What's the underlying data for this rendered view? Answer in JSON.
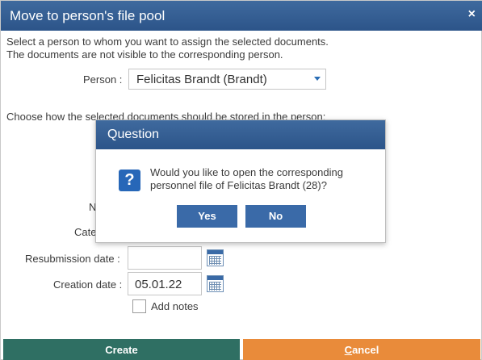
{
  "window": {
    "title": "Move to person's file pool",
    "close_glyph": "×"
  },
  "intro": {
    "line1": "Select a person to whom you want to assign the selected documents.",
    "line2": "The documents are not visible to the corresponding person."
  },
  "person": {
    "label": "Person :",
    "value": "Felicitas Brandt (Brandt)"
  },
  "storage": {
    "text": "Choose how the selected documents should be stored in the person:"
  },
  "fields": {
    "name_label_partial": "N",
    "category_label_partial": "Cate",
    "resubmission_label": "Resubmission date :",
    "resubmission_value": "",
    "creation_label": "Creation date :",
    "creation_value": "05.01.22",
    "add_notes_label": "Add notes",
    "add_notes_checked": false
  },
  "buttons": {
    "create": "Create",
    "cancel_first": "C",
    "cancel_rest": "ancel"
  },
  "question_modal": {
    "title": "Question",
    "icon": "question-mark-icon",
    "icon_glyph": "?",
    "line1": "Would you like to open the corresponding",
    "line2": "personnel file of Felicitas Brandt (28)?",
    "yes": "Yes",
    "no": "No"
  },
  "colors": {
    "titlebar": "#2c5489",
    "create_button": "#2f6f63",
    "cancel_button": "#e98b3a",
    "modal_button": "#3a6aa8",
    "question_icon": "#2767b8"
  }
}
